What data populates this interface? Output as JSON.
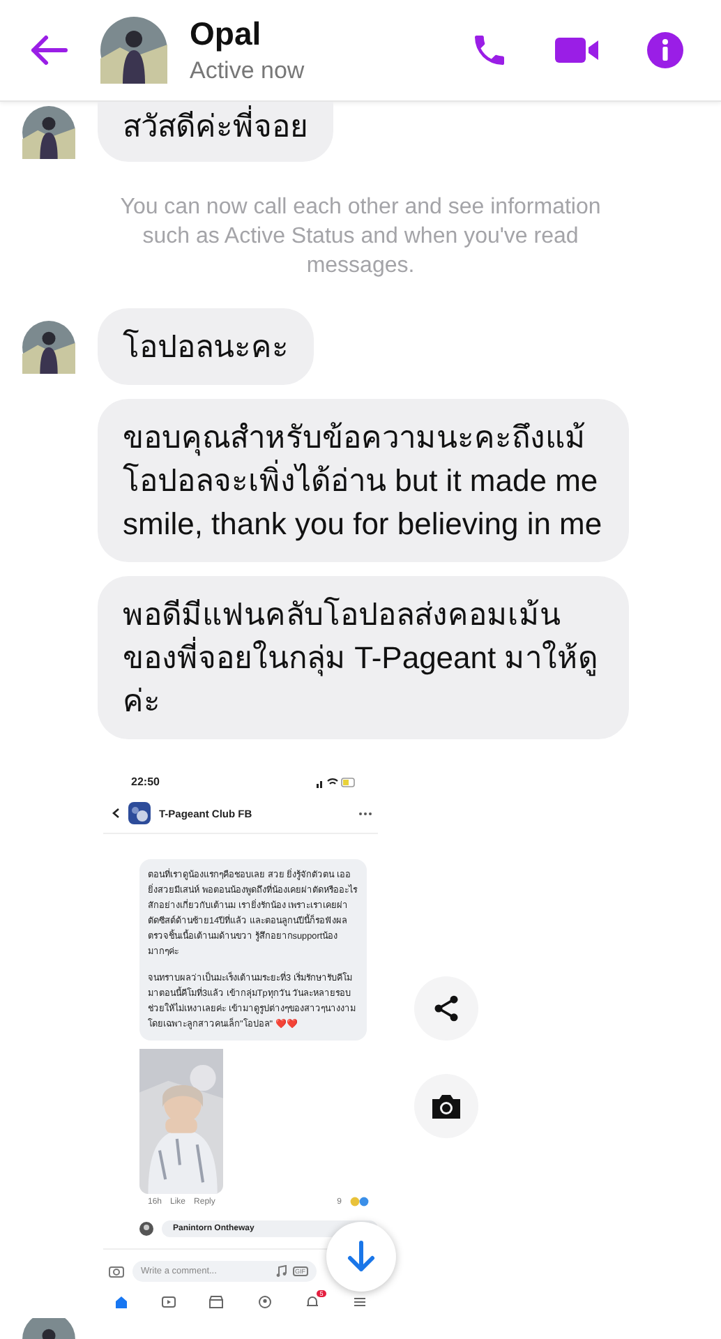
{
  "header": {
    "name": "Opal",
    "status": "Active now"
  },
  "messages": [
    {
      "kind": "text",
      "text": "สวัสดีค่ะพี่จอย",
      "avatar": true
    },
    {
      "kind": "notice",
      "text": "You can now call each other and see information such as Active Status and when you've read messages."
    },
    {
      "kind": "text",
      "text": "โอปอลนะคะ",
      "avatar": true
    },
    {
      "kind": "text",
      "text": "ขอบคุณสำหรับข้อความนะคะถึงแม้โอปอลจะเพิ่งได้อ่าน but it made me smile, thank you for believing in me",
      "avatar": false
    },
    {
      "kind": "text",
      "text": "พอดีมีแฟนคลับโอปอลส่งคอมเม้นของพี่จอยในกลุ่ม T-Pageant มาให้ดูค่ะ",
      "avatar": false
    },
    {
      "avatar": true,
      "screenshot": {
        "time": "22:50",
        "group": "T-Pageant Club FB",
        "comment_paragraphs": [
          "ตอนที่เราดูน้องแรกๆคือชอบเลย สวย ยิ่งรู้จักตัวตน เออยิ่งสวยมีเสน่ห์ พอตอนน้องพูดถึงที่น้องเคยผ่าตัดหรืออะไรสักอย่างเกี่ยวกับเต้านม เรายิ่งรักน้อง เพราะเราเคยผ่าตัดซีสต์ด้านซ้าย14ปีที่แล้ว และตอนลูกนปีนี้ก็รอฟังผลตรวจชิ้นเนื้อเต้านมด้านขวา รู้สึกอยากsupportน้องมากๆค่ะ",
          "จนทราบผลว่าเป็นมะเร็งเต้านมระยะที่3 เริ่มรักษารับคีโม มาตอนนี้คีโมที่3แล้ว เข้ากลุ่มTpทุกวัน วันละหลายรอบ ช่วยให้ไม่เหงาเลยค่ะ เข้ามาดูรูปต่างๆของสาวๆนางงาม โดยเฉพาะลูกสาวคนเล็ก\"โอปอล\" ❤️❤️"
        ],
        "comment_time": "16h",
        "actions": [
          "Like",
          "Reply"
        ],
        "reaction_count": "9",
        "reply_author": "Panintorn Ontheway",
        "comment_placeholder": "Write a comment...",
        "gif_label": "GIF",
        "notification_badge": "5"
      }
    }
  ]
}
